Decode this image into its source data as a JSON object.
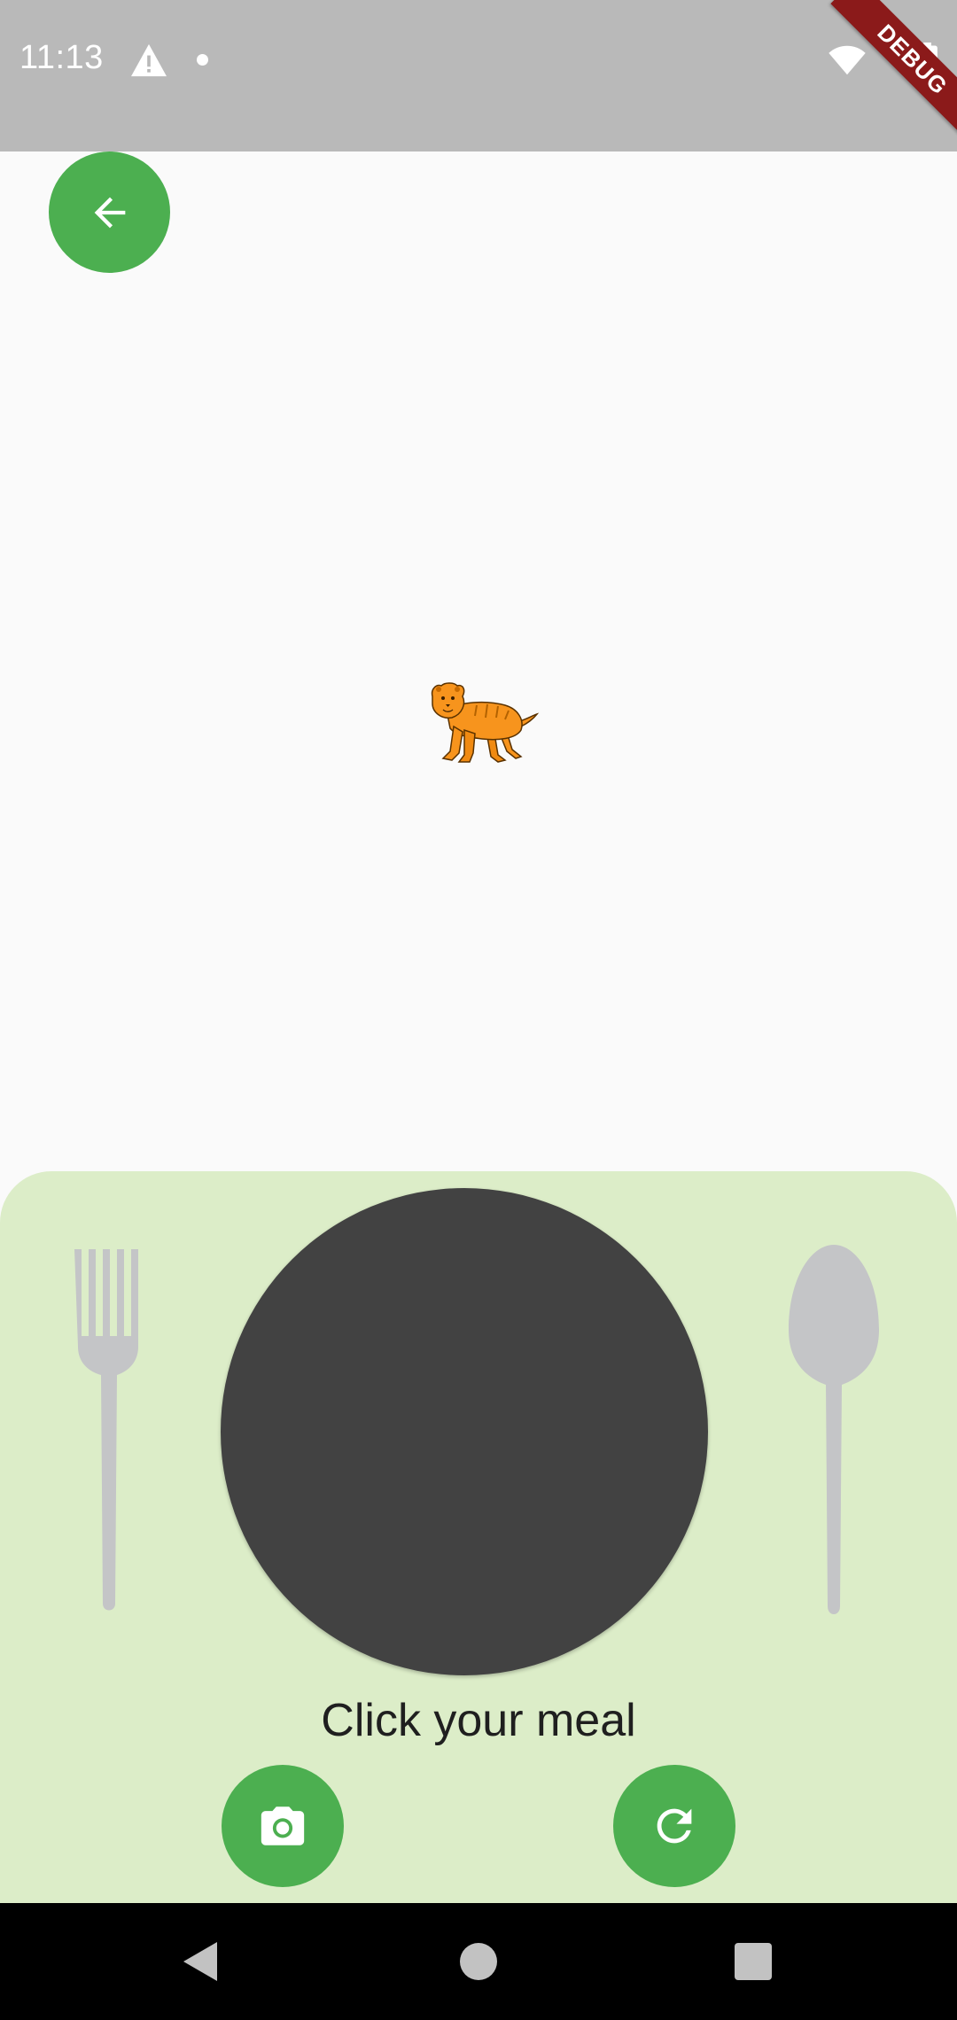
{
  "status_bar": {
    "time": "11:13",
    "icons": [
      "warning-icon",
      "notification-dot-icon",
      "wifi-icon",
      "battery-icon"
    ],
    "background_color": "#b9b9b9"
  },
  "debug_banner": {
    "label": "DEBUG",
    "color": "#8b1a1a"
  },
  "back_button": {
    "icon": "arrow-back-icon",
    "color": "#4caf50"
  },
  "mascot": {
    "icon": "tiger-icon"
  },
  "meal_panel": {
    "background_color": "#dcedc8",
    "plate_color": "#424242",
    "utensils": [
      "fork-icon",
      "spoon-icon"
    ],
    "prompt": "Click your meal",
    "actions": [
      {
        "name": "camera-button",
        "icon": "camera-icon"
      },
      {
        "name": "refresh-button",
        "icon": "refresh-icon"
      }
    ]
  },
  "nav_bar": {
    "buttons": [
      "back-triangle-icon",
      "home-circle-icon",
      "recents-square-icon"
    ]
  }
}
